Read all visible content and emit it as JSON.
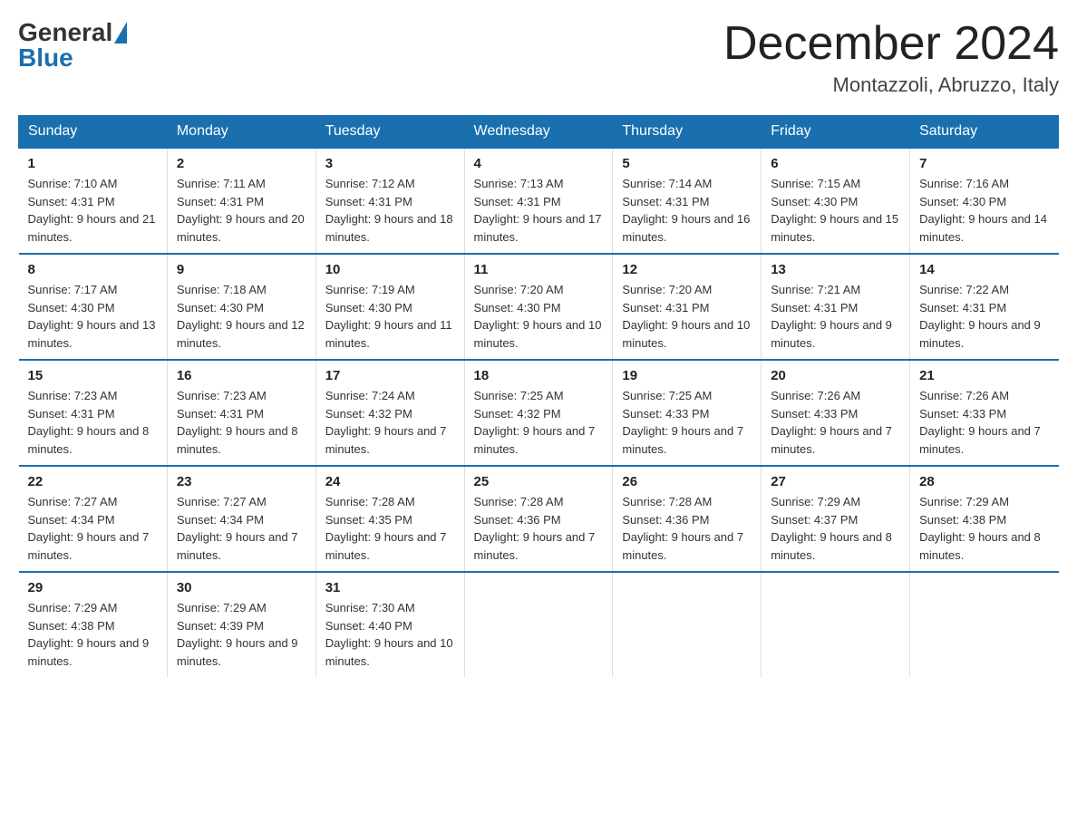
{
  "header": {
    "logo_general": "General",
    "logo_blue": "Blue",
    "month_title": "December 2024",
    "location": "Montazzoli, Abruzzo, Italy"
  },
  "days_of_week": [
    "Sunday",
    "Monday",
    "Tuesday",
    "Wednesday",
    "Thursday",
    "Friday",
    "Saturday"
  ],
  "weeks": [
    [
      {
        "day": "1",
        "sunrise": "7:10 AM",
        "sunset": "4:31 PM",
        "daylight": "9 hours and 21 minutes."
      },
      {
        "day": "2",
        "sunrise": "7:11 AM",
        "sunset": "4:31 PM",
        "daylight": "9 hours and 20 minutes."
      },
      {
        "day": "3",
        "sunrise": "7:12 AM",
        "sunset": "4:31 PM",
        "daylight": "9 hours and 18 minutes."
      },
      {
        "day": "4",
        "sunrise": "7:13 AM",
        "sunset": "4:31 PM",
        "daylight": "9 hours and 17 minutes."
      },
      {
        "day": "5",
        "sunrise": "7:14 AM",
        "sunset": "4:31 PM",
        "daylight": "9 hours and 16 minutes."
      },
      {
        "day": "6",
        "sunrise": "7:15 AM",
        "sunset": "4:30 PM",
        "daylight": "9 hours and 15 minutes."
      },
      {
        "day": "7",
        "sunrise": "7:16 AM",
        "sunset": "4:30 PM",
        "daylight": "9 hours and 14 minutes."
      }
    ],
    [
      {
        "day": "8",
        "sunrise": "7:17 AM",
        "sunset": "4:30 PM",
        "daylight": "9 hours and 13 minutes."
      },
      {
        "day": "9",
        "sunrise": "7:18 AM",
        "sunset": "4:30 PM",
        "daylight": "9 hours and 12 minutes."
      },
      {
        "day": "10",
        "sunrise": "7:19 AM",
        "sunset": "4:30 PM",
        "daylight": "9 hours and 11 minutes."
      },
      {
        "day": "11",
        "sunrise": "7:20 AM",
        "sunset": "4:30 PM",
        "daylight": "9 hours and 10 minutes."
      },
      {
        "day": "12",
        "sunrise": "7:20 AM",
        "sunset": "4:31 PM",
        "daylight": "9 hours and 10 minutes."
      },
      {
        "day": "13",
        "sunrise": "7:21 AM",
        "sunset": "4:31 PM",
        "daylight": "9 hours and 9 minutes."
      },
      {
        "day": "14",
        "sunrise": "7:22 AM",
        "sunset": "4:31 PM",
        "daylight": "9 hours and 9 minutes."
      }
    ],
    [
      {
        "day": "15",
        "sunrise": "7:23 AM",
        "sunset": "4:31 PM",
        "daylight": "9 hours and 8 minutes."
      },
      {
        "day": "16",
        "sunrise": "7:23 AM",
        "sunset": "4:31 PM",
        "daylight": "9 hours and 8 minutes."
      },
      {
        "day": "17",
        "sunrise": "7:24 AM",
        "sunset": "4:32 PM",
        "daylight": "9 hours and 7 minutes."
      },
      {
        "day": "18",
        "sunrise": "7:25 AM",
        "sunset": "4:32 PM",
        "daylight": "9 hours and 7 minutes."
      },
      {
        "day": "19",
        "sunrise": "7:25 AM",
        "sunset": "4:33 PM",
        "daylight": "9 hours and 7 minutes."
      },
      {
        "day": "20",
        "sunrise": "7:26 AM",
        "sunset": "4:33 PM",
        "daylight": "9 hours and 7 minutes."
      },
      {
        "day": "21",
        "sunrise": "7:26 AM",
        "sunset": "4:33 PM",
        "daylight": "9 hours and 7 minutes."
      }
    ],
    [
      {
        "day": "22",
        "sunrise": "7:27 AM",
        "sunset": "4:34 PM",
        "daylight": "9 hours and 7 minutes."
      },
      {
        "day": "23",
        "sunrise": "7:27 AM",
        "sunset": "4:34 PM",
        "daylight": "9 hours and 7 minutes."
      },
      {
        "day": "24",
        "sunrise": "7:28 AM",
        "sunset": "4:35 PM",
        "daylight": "9 hours and 7 minutes."
      },
      {
        "day": "25",
        "sunrise": "7:28 AM",
        "sunset": "4:36 PM",
        "daylight": "9 hours and 7 minutes."
      },
      {
        "day": "26",
        "sunrise": "7:28 AM",
        "sunset": "4:36 PM",
        "daylight": "9 hours and 7 minutes."
      },
      {
        "day": "27",
        "sunrise": "7:29 AM",
        "sunset": "4:37 PM",
        "daylight": "9 hours and 8 minutes."
      },
      {
        "day": "28",
        "sunrise": "7:29 AM",
        "sunset": "4:38 PM",
        "daylight": "9 hours and 8 minutes."
      }
    ],
    [
      {
        "day": "29",
        "sunrise": "7:29 AM",
        "sunset": "4:38 PM",
        "daylight": "9 hours and 9 minutes."
      },
      {
        "day": "30",
        "sunrise": "7:29 AM",
        "sunset": "4:39 PM",
        "daylight": "9 hours and 9 minutes."
      },
      {
        "day": "31",
        "sunrise": "7:30 AM",
        "sunset": "4:40 PM",
        "daylight": "9 hours and 10 minutes."
      },
      {
        "day": "",
        "sunrise": "",
        "sunset": "",
        "daylight": ""
      },
      {
        "day": "",
        "sunrise": "",
        "sunset": "",
        "daylight": ""
      },
      {
        "day": "",
        "sunrise": "",
        "sunset": "",
        "daylight": ""
      },
      {
        "day": "",
        "sunrise": "",
        "sunset": "",
        "daylight": ""
      }
    ]
  ]
}
